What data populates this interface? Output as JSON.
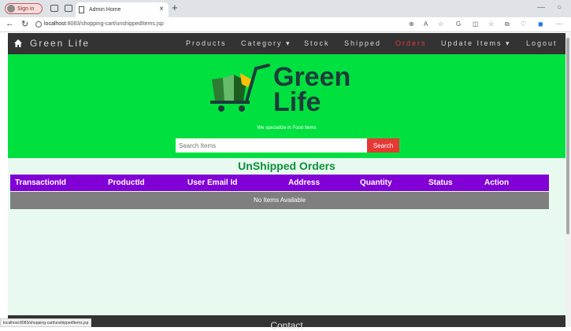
{
  "browser": {
    "signin_label": "Sign in",
    "tab_title": "Admin Home",
    "tab_close": "×",
    "new_tab": "+",
    "url_host": "localhost",
    "url_rest": ":8083/shopping-cart/unshippedItems.jsp",
    "status_url": "localhost:8083/shopping-cart/unshippedItems.jsp"
  },
  "navbar": {
    "brand": "Green Life",
    "items": [
      "Products",
      "Category ▾",
      "Stock",
      "Shipped",
      "Orders",
      "Update Items ▾",
      "Logout"
    ],
    "active_item": "Orders"
  },
  "hero": {
    "logo_line1": "Green",
    "logo_line2": "Life",
    "tagline": "We specialize in Food Items",
    "search_placeholder": "Search Items",
    "search_button": "Search"
  },
  "main": {
    "heading": "UnShipped Orders",
    "columns": [
      "TransactionId",
      "ProductId",
      "User Email Id",
      "Address",
      "Quantity",
      "Status",
      "Action"
    ],
    "empty_message": "No Items Available"
  },
  "footer": {
    "title": "Contact"
  },
  "colors": {
    "hero_green": "#00e03f",
    "table_header": "#8000d6",
    "accent_red": "#e53935",
    "heading_green": "#0d8f3a",
    "navbar": "#333333"
  }
}
